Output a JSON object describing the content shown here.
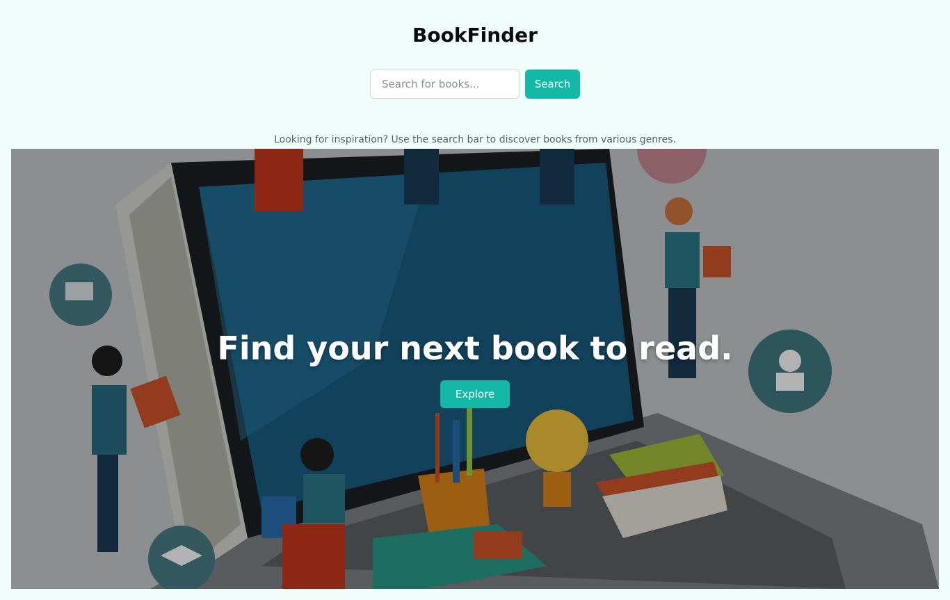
{
  "header": {
    "title": "BookFinder"
  },
  "search": {
    "placeholder": "Search for books...",
    "value": "",
    "button_label": "Search"
  },
  "tagline": "Looking for inspiration? Use the search bar to discover books from various genres.",
  "hero": {
    "heading": "Find your next book to read.",
    "cta_label": "Explore"
  },
  "colors": {
    "accent": "#14b8a6",
    "background": "#f0fdfa"
  }
}
